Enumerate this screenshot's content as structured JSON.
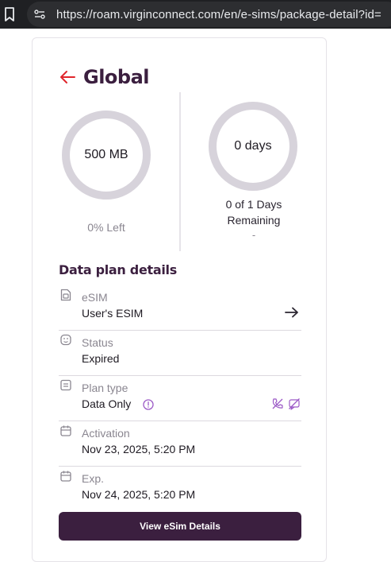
{
  "browser": {
    "url": "https://roam.virginconnect.com/en/e-sims/package-detail?id="
  },
  "header": {
    "title": "Global",
    "back_icon": "arrow-left-icon"
  },
  "usage": {
    "data": {
      "value": "500 MB",
      "caption": "0% Left",
      "fraction_left": 0
    },
    "days": {
      "value": "0 days",
      "caption_line1": "0 of 1 Days",
      "caption_line2": "Remaining",
      "caption_line3": "-"
    }
  },
  "details": {
    "heading": "Data plan details",
    "esim": {
      "label": "eSIM",
      "value": "User's ESIM"
    },
    "status": {
      "label": "Status",
      "value": "Expired"
    },
    "plan_type": {
      "label": "Plan type",
      "value": "Data Only"
    },
    "activation": {
      "label": "Activation",
      "value": "Nov 23, 2025, 5:20 PM"
    },
    "expiry": {
      "label": "Exp.",
      "value": "Nov 24, 2025, 5:20 PM"
    }
  },
  "cta": {
    "label": "View eSim Details"
  },
  "colors": {
    "brand": "#3b1f3f",
    "accent_red": "#e0262c",
    "ring": "#d7d3db",
    "icon_purple": "#9b59c6"
  }
}
